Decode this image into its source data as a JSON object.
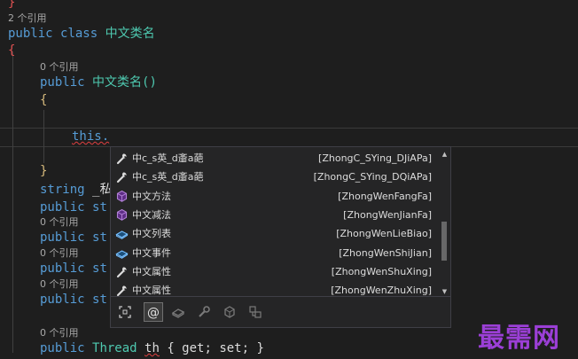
{
  "editor": {
    "top_brace": "}",
    "ref_class": "2 个引用",
    "class_kw1": "public",
    "class_kw2": "class",
    "class_name": "中文类名",
    "open_brace": "{",
    "ref_ctor": "0 个引用",
    "ctor_kw": "public",
    "ctor_name": "中文类名()",
    "ctor_open": "{",
    "this_text": "this.",
    "ctor_close": "}",
    "field_type": "string",
    "field_name": "_私",
    "prop1_kw": "public",
    "prop1_type": "st",
    "ref_p2": "0 个引用",
    "prop2_kw": "public",
    "prop2_type": "st",
    "ref_p3": "0 个引用",
    "prop3_kw": "public",
    "prop3_type": "st",
    "ref_p4": "0 个引用",
    "prop4_kw": "public",
    "prop4_type": "st",
    "ref_thread": "0 个引用",
    "thread_kw": "public",
    "thread_type": "Thread",
    "thread_name": "th",
    "thread_accessors": "{ get; set; }"
  },
  "completion": {
    "items": [
      {
        "icon": "wrench-icon",
        "name": "中c_s英_d齑a葩",
        "pinyin": "[ZhongC_SYing_DJiAPa]"
      },
      {
        "icon": "wrench-icon",
        "name": "中c_s英_d齑a葩",
        "pinyin": "[ZhongC_SYing_DQiAPa]"
      },
      {
        "icon": "method-cube-icon",
        "name": "中文方法",
        "pinyin": "[ZhongWenFangFa]"
      },
      {
        "icon": "method-cube-icon",
        "name": "中文减法",
        "pinyin": "[ZhongWenJianFa]"
      },
      {
        "icon": "field-icon",
        "name": "中文列表",
        "pinyin": "[ZhongWenLieBiao]"
      },
      {
        "icon": "field-icon",
        "name": "中文事件",
        "pinyin": "[ZhongWenShiJian]"
      },
      {
        "icon": "wrench-icon",
        "name": "中文属性",
        "pinyin": "[ZhongWenShuXing]"
      },
      {
        "icon": "wrench-icon",
        "name": "中文属性",
        "pinyin": "[ZhongWenZhuXing]"
      }
    ],
    "filters": [
      "expand-icon",
      "at-sign-icon",
      "field-filter-icon",
      "property-filter-icon",
      "method-filter-icon",
      "namespace-filter-icon"
    ],
    "active_filter": "at-sign-icon"
  },
  "watermark": "最需网",
  "colors": {
    "keyword": "#569cd6",
    "type": "#4ec9b0",
    "brace": "#d7ba7d",
    "method": "#b180d7",
    "field": "#75beff"
  }
}
